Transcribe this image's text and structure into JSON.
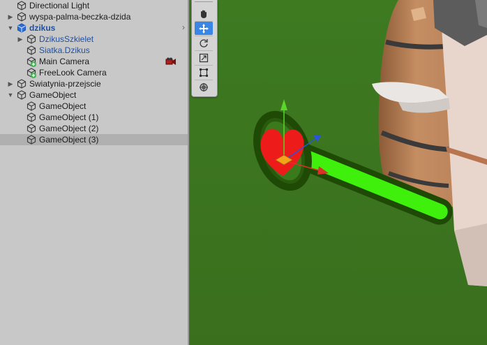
{
  "hierarchy": {
    "items": [
      {
        "label": "Directional Light",
        "depth": 0,
        "fold": "",
        "icon": "gameobject-icon",
        "type": "normal"
      },
      {
        "label": "wyspa-palma-beczka-dzida",
        "depth": 0,
        "fold": "collapsed",
        "icon": "gameobject-icon",
        "type": "normal"
      },
      {
        "label": "dzikus",
        "depth": 0,
        "fold": "expanded",
        "icon": "prefab-icon",
        "type": "prefab-root"
      },
      {
        "label": "DzikusSzkielet",
        "depth": 1,
        "fold": "collapsed",
        "icon": "gameobject-icon",
        "type": "prefab"
      },
      {
        "label": "Siatka.Dzikus",
        "depth": 1,
        "fold": "",
        "icon": "gameobject-icon",
        "type": "prefab"
      },
      {
        "label": "Main Camera",
        "depth": 1,
        "fold": "",
        "icon": "gameobject-added-icon",
        "type": "normal"
      },
      {
        "label": "FreeLook Camera",
        "depth": 1,
        "fold": "",
        "icon": "gameobject-added-icon",
        "type": "normal"
      },
      {
        "label": "Swiatynia-przejscie",
        "depth": 0,
        "fold": "collapsed",
        "icon": "gameobject-icon",
        "type": "normal"
      },
      {
        "label": "GameObject",
        "depth": 0,
        "fold": "expanded",
        "icon": "gameobject-icon",
        "type": "normal"
      },
      {
        "label": "GameObject",
        "depth": 1,
        "fold": "",
        "icon": "gameobject-icon",
        "type": "normal"
      },
      {
        "label": "GameObject (1)",
        "depth": 1,
        "fold": "",
        "icon": "gameobject-icon",
        "type": "normal"
      },
      {
        "label": "GameObject (2)",
        "depth": 1,
        "fold": "",
        "icon": "gameobject-icon",
        "type": "normal"
      },
      {
        "label": "GameObject (3)",
        "depth": 1,
        "fold": "",
        "icon": "gameobject-icon",
        "type": "normal",
        "selected": true
      }
    ]
  },
  "scene": {
    "tools": [
      {
        "name": "hand-tool",
        "icon": "hand-icon",
        "active": false
      },
      {
        "name": "move-tool",
        "icon": "move-icon",
        "active": true
      },
      {
        "name": "rotate-tool",
        "icon": "rotate-icon",
        "active": false
      },
      {
        "name": "scale-tool",
        "icon": "scale-icon",
        "active": false
      },
      {
        "name": "rect-tool",
        "icon": "rect-icon",
        "active": false
      },
      {
        "name": "transform-tool",
        "icon": "transform-icon",
        "active": false
      }
    ]
  },
  "colors": {
    "panel_bg": "#c8c8c8",
    "selected_row": "#b0b0b0",
    "prefab_text": "#1f4f9e",
    "tool_active": "#3a86e6",
    "ground": "#3f7a22",
    "health_fill": "#3ef00c",
    "health_outline": "#1e4a06",
    "heart": "#ee1b1b"
  }
}
